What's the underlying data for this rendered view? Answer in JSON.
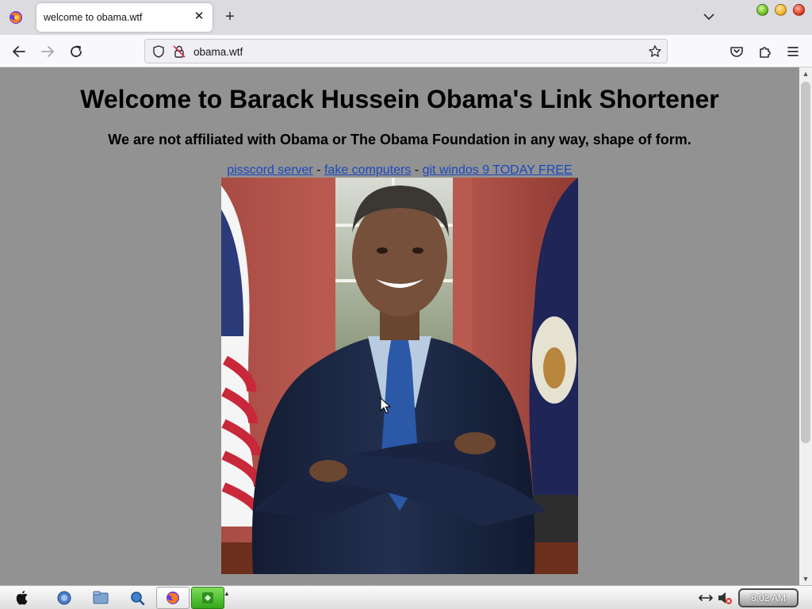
{
  "browser": {
    "tab_title": "welcome to obama.wtf",
    "url": "obama.wtf"
  },
  "page": {
    "title": "Welcome to Barack Hussein Obama's Link Shortener",
    "subtitle": "We are not affiliated with Obama or The Obama Foundation in any way, shape of form.",
    "links": [
      {
        "label": "pisscord server"
      },
      {
        "label": "fake computers"
      },
      {
        "label": "git windos 9 TODAY FREE"
      }
    ],
    "separator": " - ",
    "background_color": "#929292",
    "link_color": "#1948c0"
  },
  "taskbar": {
    "clock": "8:02 AM"
  }
}
